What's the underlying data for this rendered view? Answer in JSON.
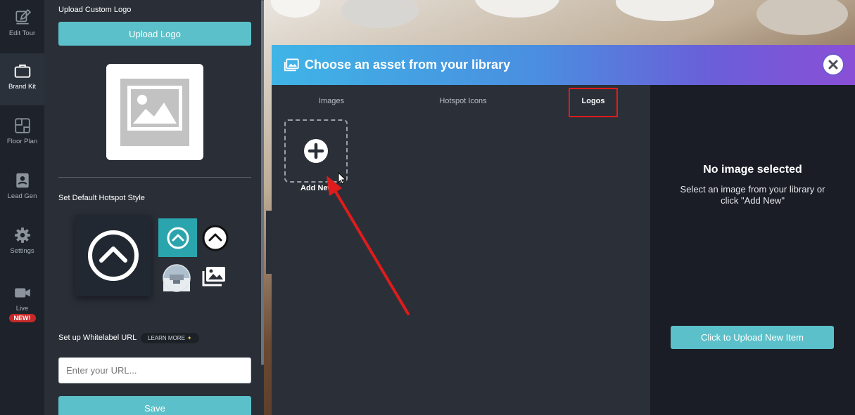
{
  "rail": {
    "items": [
      {
        "label": "Edit Tour",
        "icon": "edit-icon"
      },
      {
        "label": "Brand Kit",
        "icon": "briefcase-icon"
      },
      {
        "label": "Floor Plan",
        "icon": "floor-plan-icon"
      },
      {
        "label": "Lead Gen",
        "icon": "contact-book-icon"
      },
      {
        "label": "Settings",
        "icon": "gear-icon"
      },
      {
        "label": "Live",
        "icon": "video-camera-icon",
        "badge": "NEW!"
      }
    ]
  },
  "brand_panel": {
    "logo_heading": "Upload Custom Logo",
    "upload_logo_label": "Upload Logo",
    "hotspot_heading": "Set Default Hotspot Style",
    "whitelabel_heading": "Set up Whitelabel URL",
    "learn_more_label": "LEARN MORE",
    "url_placeholder": "Enter your URL...",
    "save_label": "Save"
  },
  "modal": {
    "title": "Choose an asset from your library",
    "tabs": [
      {
        "label": "Images",
        "active": false
      },
      {
        "label": "Hotspot Icons",
        "active": false
      },
      {
        "label": "Logos",
        "active": true
      }
    ],
    "add_new_label": "Add New",
    "no_image_title": "No image selected",
    "no_image_subtitle": "Select an image from your library or click \"Add New\"",
    "upload_new_label": "Click to Upload New Item"
  },
  "colors": {
    "accent_teal": "#5bc0c9",
    "header_gradient_start": "#3fb4e6",
    "header_gradient_end": "#8a4fd6",
    "annotation_red": "#e01b1b",
    "new_badge": "#c62828"
  }
}
